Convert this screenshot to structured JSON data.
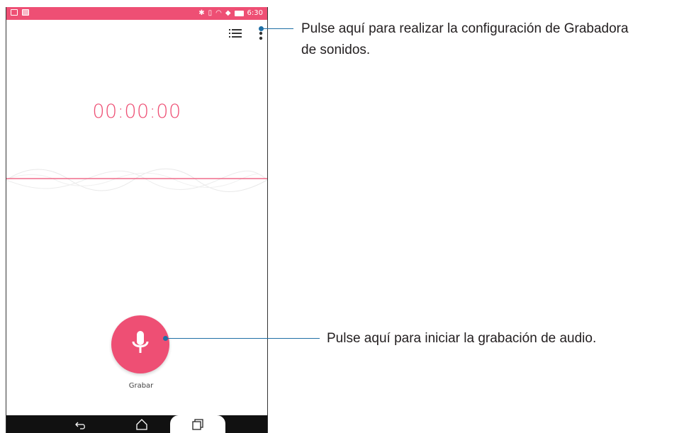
{
  "status_bar": {
    "time": "6:30",
    "color": "#ee4f74",
    "icons": [
      "notification-icon",
      "photo-icon",
      "bluetooth-icon",
      "vibrate-icon",
      "wifi-icon",
      "battery-saver-icon",
      "battery-icon"
    ]
  },
  "toolbar": {
    "icons": [
      "list-icon",
      "more-options-icon"
    ]
  },
  "recorder": {
    "timer": "00:00:00",
    "record_label": "Grabar",
    "accent_color": "#ee4f74"
  },
  "nav": {
    "icons": [
      "back-icon",
      "home-icon",
      "recent-apps-icon"
    ]
  },
  "callouts": {
    "settings": "Pulse aquí para realizar la configuración de Grabadora de sonidos.",
    "settings_line1": "Pulse aquí para realizar la configuración de Grabadora",
    "settings_line2": "de sonidos.",
    "record": "Pulse aquí para iniciar la grabación de audio.",
    "line_color": "#1f6fa5"
  }
}
